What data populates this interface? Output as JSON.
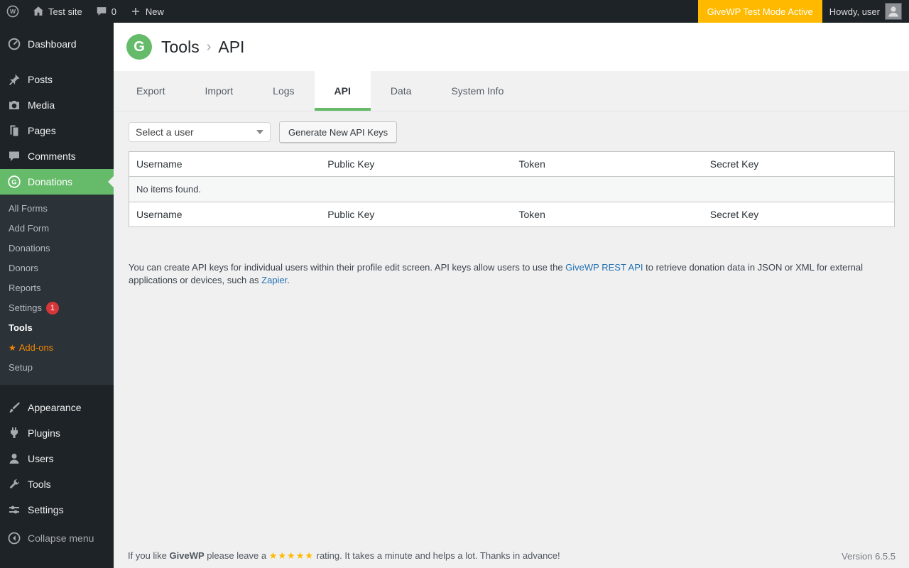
{
  "colors": {
    "accent_green": "#66bb6a",
    "test_mode_orange": "#ffba00",
    "badge_red": "#d63638",
    "link_blue": "#2271b1",
    "addons_orange": "#f18500"
  },
  "admin_bar": {
    "wp_logo_letter": "W",
    "site_name": "Test site",
    "comments_count": "0",
    "new_label": "New",
    "test_mode_label": "GiveWP Test Mode Active",
    "howdy_label": "Howdy, user"
  },
  "sidebar": {
    "top_items": [
      {
        "label": "Dashboard",
        "icon": "dashboard-icon"
      },
      {
        "label": "Posts",
        "icon": "posts-icon"
      },
      {
        "label": "Media",
        "icon": "media-icon"
      },
      {
        "label": "Pages",
        "icon": "pages-icon"
      },
      {
        "label": "Comments",
        "icon": "comments-icon"
      },
      {
        "label": "Donations",
        "icon": "givewp-icon"
      }
    ],
    "donations_submenu": [
      {
        "label": "All Forms"
      },
      {
        "label": "Add Form"
      },
      {
        "label": "Donations"
      },
      {
        "label": "Donors"
      },
      {
        "label": "Reports"
      },
      {
        "label": "Settings",
        "badge": "1"
      },
      {
        "label": "Tools"
      },
      {
        "label": "Add-ons",
        "star": "★"
      },
      {
        "label": "Setup"
      }
    ],
    "bottom_items": [
      {
        "label": "Appearance",
        "icon": "appearance-icon"
      },
      {
        "label": "Plugins",
        "icon": "plugins-icon"
      },
      {
        "label": "Users",
        "icon": "users-icon"
      },
      {
        "label": "Tools",
        "icon": "tools-icon"
      },
      {
        "label": "Settings",
        "icon": "settings-icon"
      }
    ],
    "collapse_label": "Collapse menu"
  },
  "header": {
    "logo_letter": "G",
    "breadcrumb_root": "Tools",
    "separator": "›",
    "breadcrumb_current": "API"
  },
  "tabs": [
    {
      "label": "Export"
    },
    {
      "label": "Import"
    },
    {
      "label": "Logs"
    },
    {
      "label": "API"
    },
    {
      "label": "Data"
    },
    {
      "label": "System Info"
    }
  ],
  "api_section": {
    "select_placeholder": "Select a user",
    "generate_button_label": "Generate New API Keys",
    "table": {
      "headers": [
        "Username",
        "Public Key",
        "Token",
        "Secret Key"
      ],
      "empty_text": "No items found."
    },
    "description": {
      "part1": "You can create API keys for individual users within their profile edit screen. API keys allow users to use the ",
      "link1": "GiveWP REST API",
      "part2": " to retrieve donation data in JSON or XML for external applications or devices, such as ",
      "link2": "Zapier",
      "part3": "."
    }
  },
  "footer": {
    "part1": "If you like ",
    "brand": "GiveWP",
    "part2": " please leave a ",
    "stars": "★★★★★",
    "part3": " rating. It takes a minute and helps a lot. Thanks in advance!",
    "version": "Version 6.5.5"
  }
}
